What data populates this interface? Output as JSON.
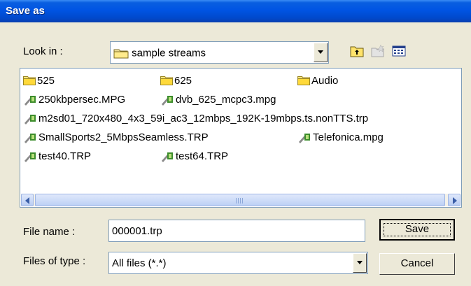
{
  "window": {
    "title": "Save as"
  },
  "look_in": {
    "label": "Look in :",
    "value": "sample streams",
    "icon": "folder-icon"
  },
  "toolbar": {
    "up_icon": "up-one-level-icon",
    "new_folder_icon": "new-folder-icon",
    "view_icon": "view-menu-icon"
  },
  "files": {
    "folders": [
      "525",
      "625",
      "Audio"
    ],
    "streams": [
      "250kbpersec.MPG",
      "dvb_625_mcpc3.mpg",
      "m2sd01_720x480_4x3_59i_ac3_12mbps_192K-19mbps.ts.nonTTS.trp",
      "SmallSports2_5MbpsSeamless.TRP",
      "Telefonica.mpg",
      "test40.TRP",
      "test64.TRP"
    ]
  },
  "file_name": {
    "label": "File name :",
    "value": "000001.trp"
  },
  "file_type": {
    "label": "Files of type :",
    "value": "All files (*.*)"
  },
  "buttons": {
    "save": "Save",
    "cancel": "Cancel"
  }
}
